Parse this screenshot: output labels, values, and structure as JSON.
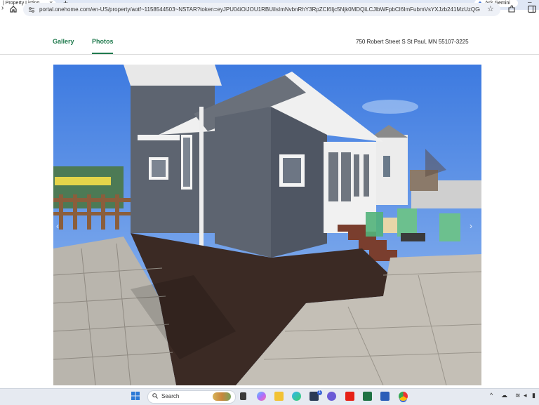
{
  "browser": {
    "tab_title": "| Property Listing",
    "ask_gemini_label": "Ask Gemini",
    "url": "portal.onehome.com/en-US/property/aotf~1158544503~NSTAR?token=eyJPU04iOiJOU1RBUiIsImNvbnRhY3RpZCI6Ijc5Njk0MDQiLCJlbWFpbCI6ImFubmVsYXJzb241MzUzQGdtYW"
  },
  "page": {
    "tabs": [
      {
        "label": "Gallery"
      },
      {
        "label": "Photos"
      }
    ],
    "active_tab": "Photos",
    "address": "750 Robert Street S St Paul, MN 55107-3225"
  },
  "taskbar": {
    "search_label": "Search",
    "notification_count": "1"
  },
  "colors": {
    "accent": "#1f7a4d",
    "house_siding": "#5d6470",
    "sky": "#5b8fe8"
  }
}
